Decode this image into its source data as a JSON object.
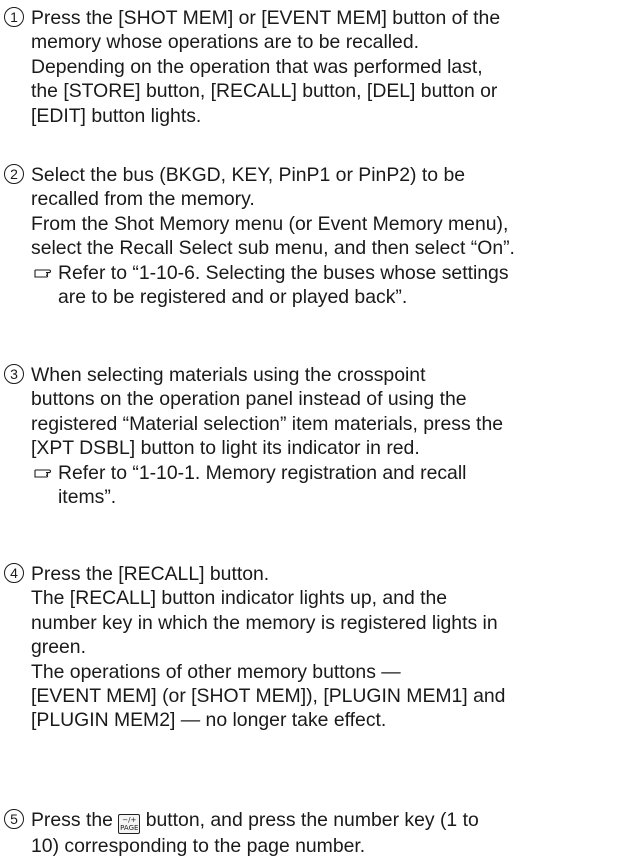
{
  "steps": [
    {
      "number": "1",
      "lines": [
        "Press the [SHOT MEM] or [EVENT MEM] button of the",
        "memory whose operations are to be recalled.",
        "Depending on the operation that was performed last,",
        "the [STORE] button, [RECALL] button, [DEL] button or",
        "[EDIT] button lights."
      ]
    },
    {
      "number": "2",
      "lines": [
        "Select the bus (BKGD, KEY, PinP1 or PinP2) to be",
        "recalled from the memory.",
        "From the Shot Memory menu (or Event Memory menu),",
        "select the Recall Select sub menu, and then select “On”."
      ],
      "ref": [
        "Refer to “1-10-6. Selecting the buses whose settings",
        "are to be registered and or played back”."
      ]
    },
    {
      "number": "3",
      "lines": [
        "When selecting materials using the crosspoint",
        "buttons on the operation panel instead of using the",
        "registered “Material selection” item materials, press the",
        "[XPT DSBL] button to light its indicator in red."
      ],
      "ref": [
        "Refer to “1-10-1. Memory registration and recall",
        "items”."
      ]
    },
    {
      "number": "4",
      "lines": [
        "Press the [RECALL] button.",
        "The [RECALL] button indicator lights up, and the",
        "number key in which the memory is registered lights in",
        "green.",
        "The operations of other memory buttons —",
        "[EVENT MEM] (or [SHOT MEM]), [PLUGIN MEM1] and",
        "[PLUGIN MEM2] — no longer take effect."
      ]
    },
    {
      "number": "5",
      "line1_before": "Press the",
      "line1_after": "button, and press the number key (1 to",
      "line2": "10) corresponding to the page number.",
      "key_top": "−/+",
      "key_bottom": "PAGE"
    }
  ]
}
